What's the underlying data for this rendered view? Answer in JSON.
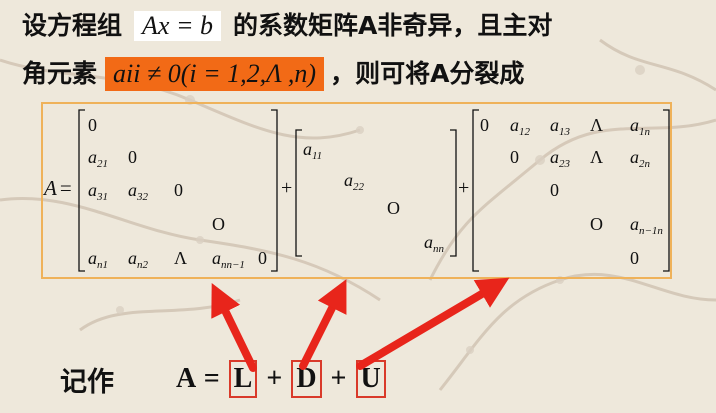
{
  "intro": {
    "line1_before": "设方程组",
    "equation": "Ax = b",
    "line1_after": "的系数矩阵A非奇异，且主对",
    "line2_before": "角元素",
    "condition": "aii ≠ 0(i = 1,2,Λ ,n)",
    "line2_after": "，则可将A分裂成"
  },
  "decomposition": {
    "lhs": "A =",
    "plus": "+",
    "lower": {
      "cells": [
        {
          "b": "0",
          "s": "",
          "r": 0,
          "c": 0
        },
        {
          "b": "a",
          "s": "21",
          "r": 1,
          "c": 0
        },
        {
          "b": "0",
          "s": "",
          "r": 1,
          "c": 1
        },
        {
          "b": "a",
          "s": "31",
          "r": 2,
          "c": 0
        },
        {
          "b": "a",
          "s": "32",
          "r": 2,
          "c": 1
        },
        {
          "b": "0",
          "s": "",
          "r": 2,
          "c": 2
        },
        {
          "b": "O",
          "s": "",
          "r": 3,
          "c": 3
        },
        {
          "b": "a",
          "s": "n1",
          "r": 4,
          "c": 0
        },
        {
          "b": "a",
          "s": "n2",
          "r": 4,
          "c": 1
        },
        {
          "b": "Λ",
          "s": "",
          "r": 4,
          "c": 2
        },
        {
          "b": "a",
          "s": "nn−1",
          "r": 4,
          "c": 3
        },
        {
          "b": "0",
          "s": "",
          "r": 4,
          "c": 4
        }
      ]
    },
    "diagonal": {
      "cells": [
        {
          "b": "a",
          "s": "11",
          "r": 0,
          "c": 0
        },
        {
          "b": "a",
          "s": "22",
          "r": 1,
          "c": 1
        },
        {
          "b": "O",
          "s": "",
          "r": 2,
          "c": 2
        },
        {
          "b": "a",
          "s": "nn",
          "r": 3,
          "c": 3
        }
      ]
    },
    "upper": {
      "cells": [
        {
          "b": "0",
          "s": "",
          "r": 0,
          "c": 0
        },
        {
          "b": "a",
          "s": "12",
          "r": 0,
          "c": 1
        },
        {
          "b": "a",
          "s": "13",
          "r": 0,
          "c": 2
        },
        {
          "b": "Λ",
          "s": "",
          "r": 0,
          "c": 3
        },
        {
          "b": "a",
          "s": "1n",
          "r": 0,
          "c": 4
        },
        {
          "b": "0",
          "s": "",
          "r": 1,
          "c": 1
        },
        {
          "b": "a",
          "s": "23",
          "r": 1,
          "c": 2
        },
        {
          "b": "Λ",
          "s": "",
          "r": 1,
          "c": 3
        },
        {
          "b": "a",
          "s": "2n",
          "r": 1,
          "c": 4
        },
        {
          "b": "0",
          "s": "",
          "r": 2,
          "c": 2
        },
        {
          "b": "O",
          "s": "",
          "r": 3,
          "c": 3
        },
        {
          "b": "a",
          "s": "n−1n",
          "r": 3,
          "c": 4
        },
        {
          "b": "0",
          "s": "",
          "r": 4,
          "c": 4
        }
      ]
    }
  },
  "notation": {
    "label": "记作",
    "lhs": "A",
    "equals": "=",
    "L": "L",
    "plus": "+",
    "D": "D",
    "U": "U"
  },
  "colors": {
    "highlight": "#f26a16",
    "frame": "#efb25a",
    "arrow": "#e8251b",
    "box": "#d93a2a"
  }
}
